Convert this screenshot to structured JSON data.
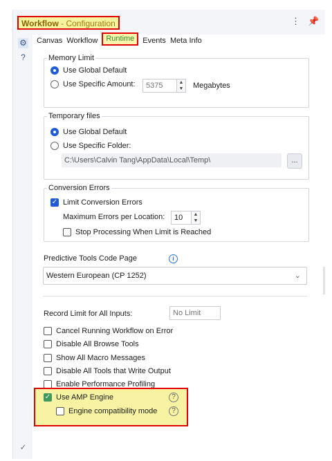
{
  "panel": {
    "title_main": "Workflow",
    "title_sub": " - Configuration",
    "menu_icon": "kebab-menu-icon",
    "pin_icon": "pin-icon"
  },
  "side_icons": [
    "gear-icon",
    "help-circle-icon",
    "check-circle-icon"
  ],
  "tabs": [
    "Canvas",
    "Workflow",
    "Runtime",
    "Events",
    "Meta Info"
  ],
  "active_tab": "Runtime",
  "memory": {
    "legend": "Memory Limit",
    "opt_global": "Use Global Default",
    "opt_specific": "Use Specific Amount:",
    "amount": "5375",
    "unit": "Megabytes",
    "selected": "global"
  },
  "temp": {
    "legend": "Temporary files",
    "opt_global": "Use Global Default",
    "opt_specific": "Use Specific Folder:",
    "path": "C:\\Users\\Calvin Tang\\AppData\\Local\\Temp\\",
    "browse": "...",
    "selected": "global"
  },
  "conversion": {
    "legend": "Conversion Errors",
    "limit_label": "Limit Conversion Errors",
    "limit_checked": true,
    "max_label": "Maximum Errors per Location:",
    "max_value": "10",
    "stop_label": "Stop Processing When Limit is Reached",
    "stop_checked": false
  },
  "predictive": {
    "label": "Predictive Tools Code Page",
    "value": "Western European (CP 1252)"
  },
  "record_limit": {
    "label": "Record Limit for All Inputs:",
    "placeholder": "No Limit"
  },
  "options": [
    {
      "label": "Cancel Running Workflow on Error",
      "checked": false
    },
    {
      "label": "Disable All Browse Tools",
      "checked": false
    },
    {
      "label": "Show All Macro Messages",
      "checked": false
    },
    {
      "label": "Disable All Tools that Write Output",
      "checked": false
    },
    {
      "label": "Enable Performance Profiling",
      "checked": false
    }
  ],
  "amp": {
    "label": "Use AMP Engine",
    "checked": true,
    "compat_label": "Engine compatibility mode",
    "compat_checked": false,
    "help": "?"
  },
  "colors": {
    "accent": "#1f5bd8",
    "highlight_border": "#e00000",
    "highlight_fill": "#f7f3a3",
    "amp_check": "#3e9a5b"
  }
}
